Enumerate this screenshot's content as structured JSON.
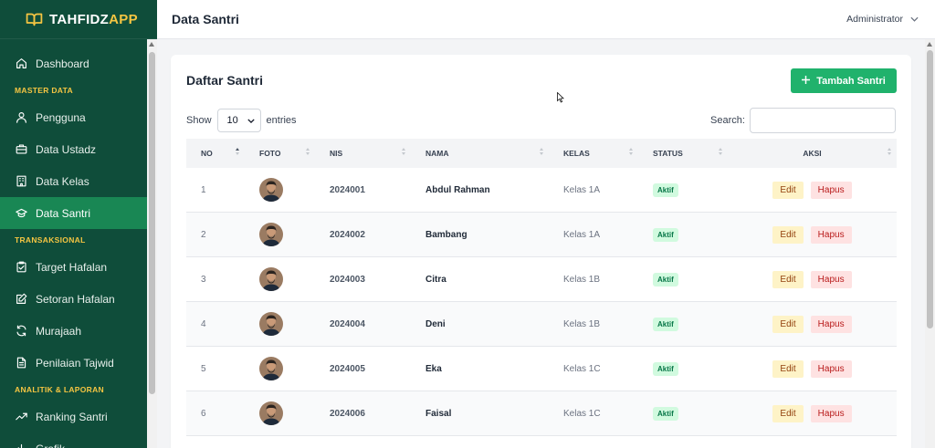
{
  "brand": {
    "name_part1": "TAHFIDZ",
    "name_part2": "APP",
    "accent": "#f5c542"
  },
  "colors": {
    "sidebar_bg": "#0f4d3a",
    "active": "#198754",
    "primary_button": "#20b26c"
  },
  "sidebar": {
    "items": [
      {
        "type": "item",
        "label": "Dashboard",
        "icon": "home-icon"
      },
      {
        "type": "section",
        "label": "MASTER DATA"
      },
      {
        "type": "item",
        "label": "Pengguna",
        "icon": "users-icon"
      },
      {
        "type": "item",
        "label": "Data Ustadz",
        "icon": "briefcase-icon"
      },
      {
        "type": "item",
        "label": "Data Kelas",
        "icon": "building-icon"
      },
      {
        "type": "item",
        "label": "Data Santri",
        "icon": "graduation-cap-icon",
        "active": true
      },
      {
        "type": "section",
        "label": "TRANSAKSIONAL"
      },
      {
        "type": "item",
        "label": "Target Hafalan",
        "icon": "clipboard-check-icon"
      },
      {
        "type": "item",
        "label": "Setoran Hafalan",
        "icon": "edit-icon"
      },
      {
        "type": "item",
        "label": "Murajaah",
        "icon": "refresh-icon"
      },
      {
        "type": "item",
        "label": "Penilaian Tajwid",
        "icon": "document-icon"
      },
      {
        "type": "section",
        "label": "ANALITIK & LAPORAN"
      },
      {
        "type": "item",
        "label": "Ranking Santri",
        "icon": "trending-up-icon"
      },
      {
        "type": "item",
        "label": "Grafik",
        "icon": "chart-icon"
      }
    ]
  },
  "header": {
    "title": "Data Santri",
    "user": "Administrator"
  },
  "card": {
    "title": "Daftar Santri",
    "add_button": "Tambah Santri",
    "show_label": "Show",
    "entries_value": "10",
    "entries_label": "entries",
    "search_label": "Search:",
    "search_value": ""
  },
  "table": {
    "columns": [
      "NO",
      "FOTO",
      "NIS",
      "NAMA",
      "KELAS",
      "STATUS",
      "AKSI"
    ],
    "sorted_column": "NO",
    "edit_label": "Edit",
    "delete_label": "Hapus",
    "rows": [
      {
        "no": "1",
        "nis": "2024001",
        "nama": "Abdul Rahman",
        "kelas": "Kelas 1A",
        "status": "Aktif"
      },
      {
        "no": "2",
        "nis": "2024002",
        "nama": "Bambang",
        "kelas": "Kelas 1A",
        "status": "Aktif"
      },
      {
        "no": "3",
        "nis": "2024003",
        "nama": "Citra",
        "kelas": "Kelas 1B",
        "status": "Aktif"
      },
      {
        "no": "4",
        "nis": "2024004",
        "nama": "Deni",
        "kelas": "Kelas 1B",
        "status": "Aktif"
      },
      {
        "no": "5",
        "nis": "2024005",
        "nama": "Eka",
        "kelas": "Kelas 1C",
        "status": "Aktif"
      },
      {
        "no": "6",
        "nis": "2024006",
        "nama": "Faisal",
        "kelas": "Kelas 1C",
        "status": "Aktif"
      }
    ]
  }
}
